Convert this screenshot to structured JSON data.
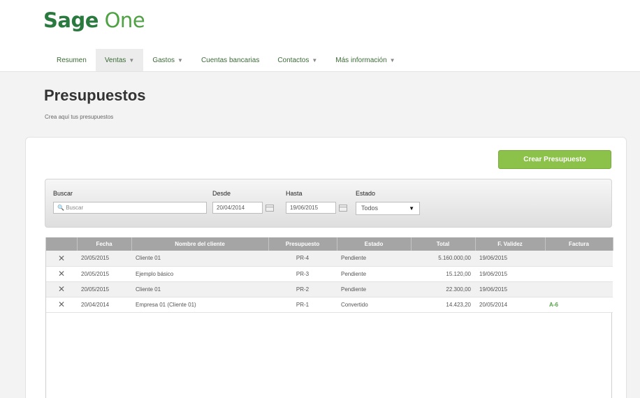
{
  "brand": {
    "part1": "Sage",
    "part2": "One"
  },
  "nav": [
    {
      "label": "Resumen",
      "has_menu": false,
      "active": false
    },
    {
      "label": "Ventas",
      "has_menu": true,
      "active": true
    },
    {
      "label": "Gastos",
      "has_menu": true,
      "active": false
    },
    {
      "label": "Cuentas bancarias",
      "has_menu": false,
      "active": false
    },
    {
      "label": "Contactos",
      "has_menu": true,
      "active": false
    },
    {
      "label": "Más información",
      "has_menu": true,
      "active": false
    }
  ],
  "page": {
    "title": "Presupuestos",
    "subtitle": "Crea aquí tus presupuestos"
  },
  "actions": {
    "create_label": "Crear Presupuesto"
  },
  "filters": {
    "search_label": "Buscar",
    "search_placeholder": "Buscar",
    "from_label": "Desde",
    "from_value": "20/04/2014",
    "to_label": "Hasta",
    "to_value": "19/06/2015",
    "status_label": "Estado",
    "status_value": "Todos"
  },
  "table": {
    "columns": [
      "",
      "Fecha",
      "Nombre del cliente",
      "Presupuesto",
      "Estado",
      "Total",
      "F. Validez",
      "Factura"
    ],
    "rows": [
      {
        "fecha": "20/05/2015",
        "cliente": "Cliente 01",
        "presupuesto": "PR-4",
        "estado": "Pendiente",
        "total": "5.160.000,00",
        "validez": "19/06/2015",
        "factura": ""
      },
      {
        "fecha": "20/05/2015",
        "cliente": "Ejemplo básico",
        "presupuesto": "PR-3",
        "estado": "Pendiente",
        "total": "15.120,00",
        "validez": "19/06/2015",
        "factura": ""
      },
      {
        "fecha": "20/05/2015",
        "cliente": "Cliente 01",
        "presupuesto": "PR-2",
        "estado": "Pendiente",
        "total": "22.300,00",
        "validez": "19/06/2015",
        "factura": ""
      },
      {
        "fecha": "20/04/2014",
        "cliente": "Empresa 01 (Cliente 01)",
        "presupuesto": "PR-1",
        "estado": "Convertido",
        "total": "14.423,20",
        "validez": "20/05/2014",
        "factura": "A-6"
      }
    ]
  },
  "colors": {
    "brand_dark": "#2a7a3f",
    "brand_light": "#4fa244",
    "button": "#8cc14a",
    "table_header": "#a5a5a5"
  }
}
